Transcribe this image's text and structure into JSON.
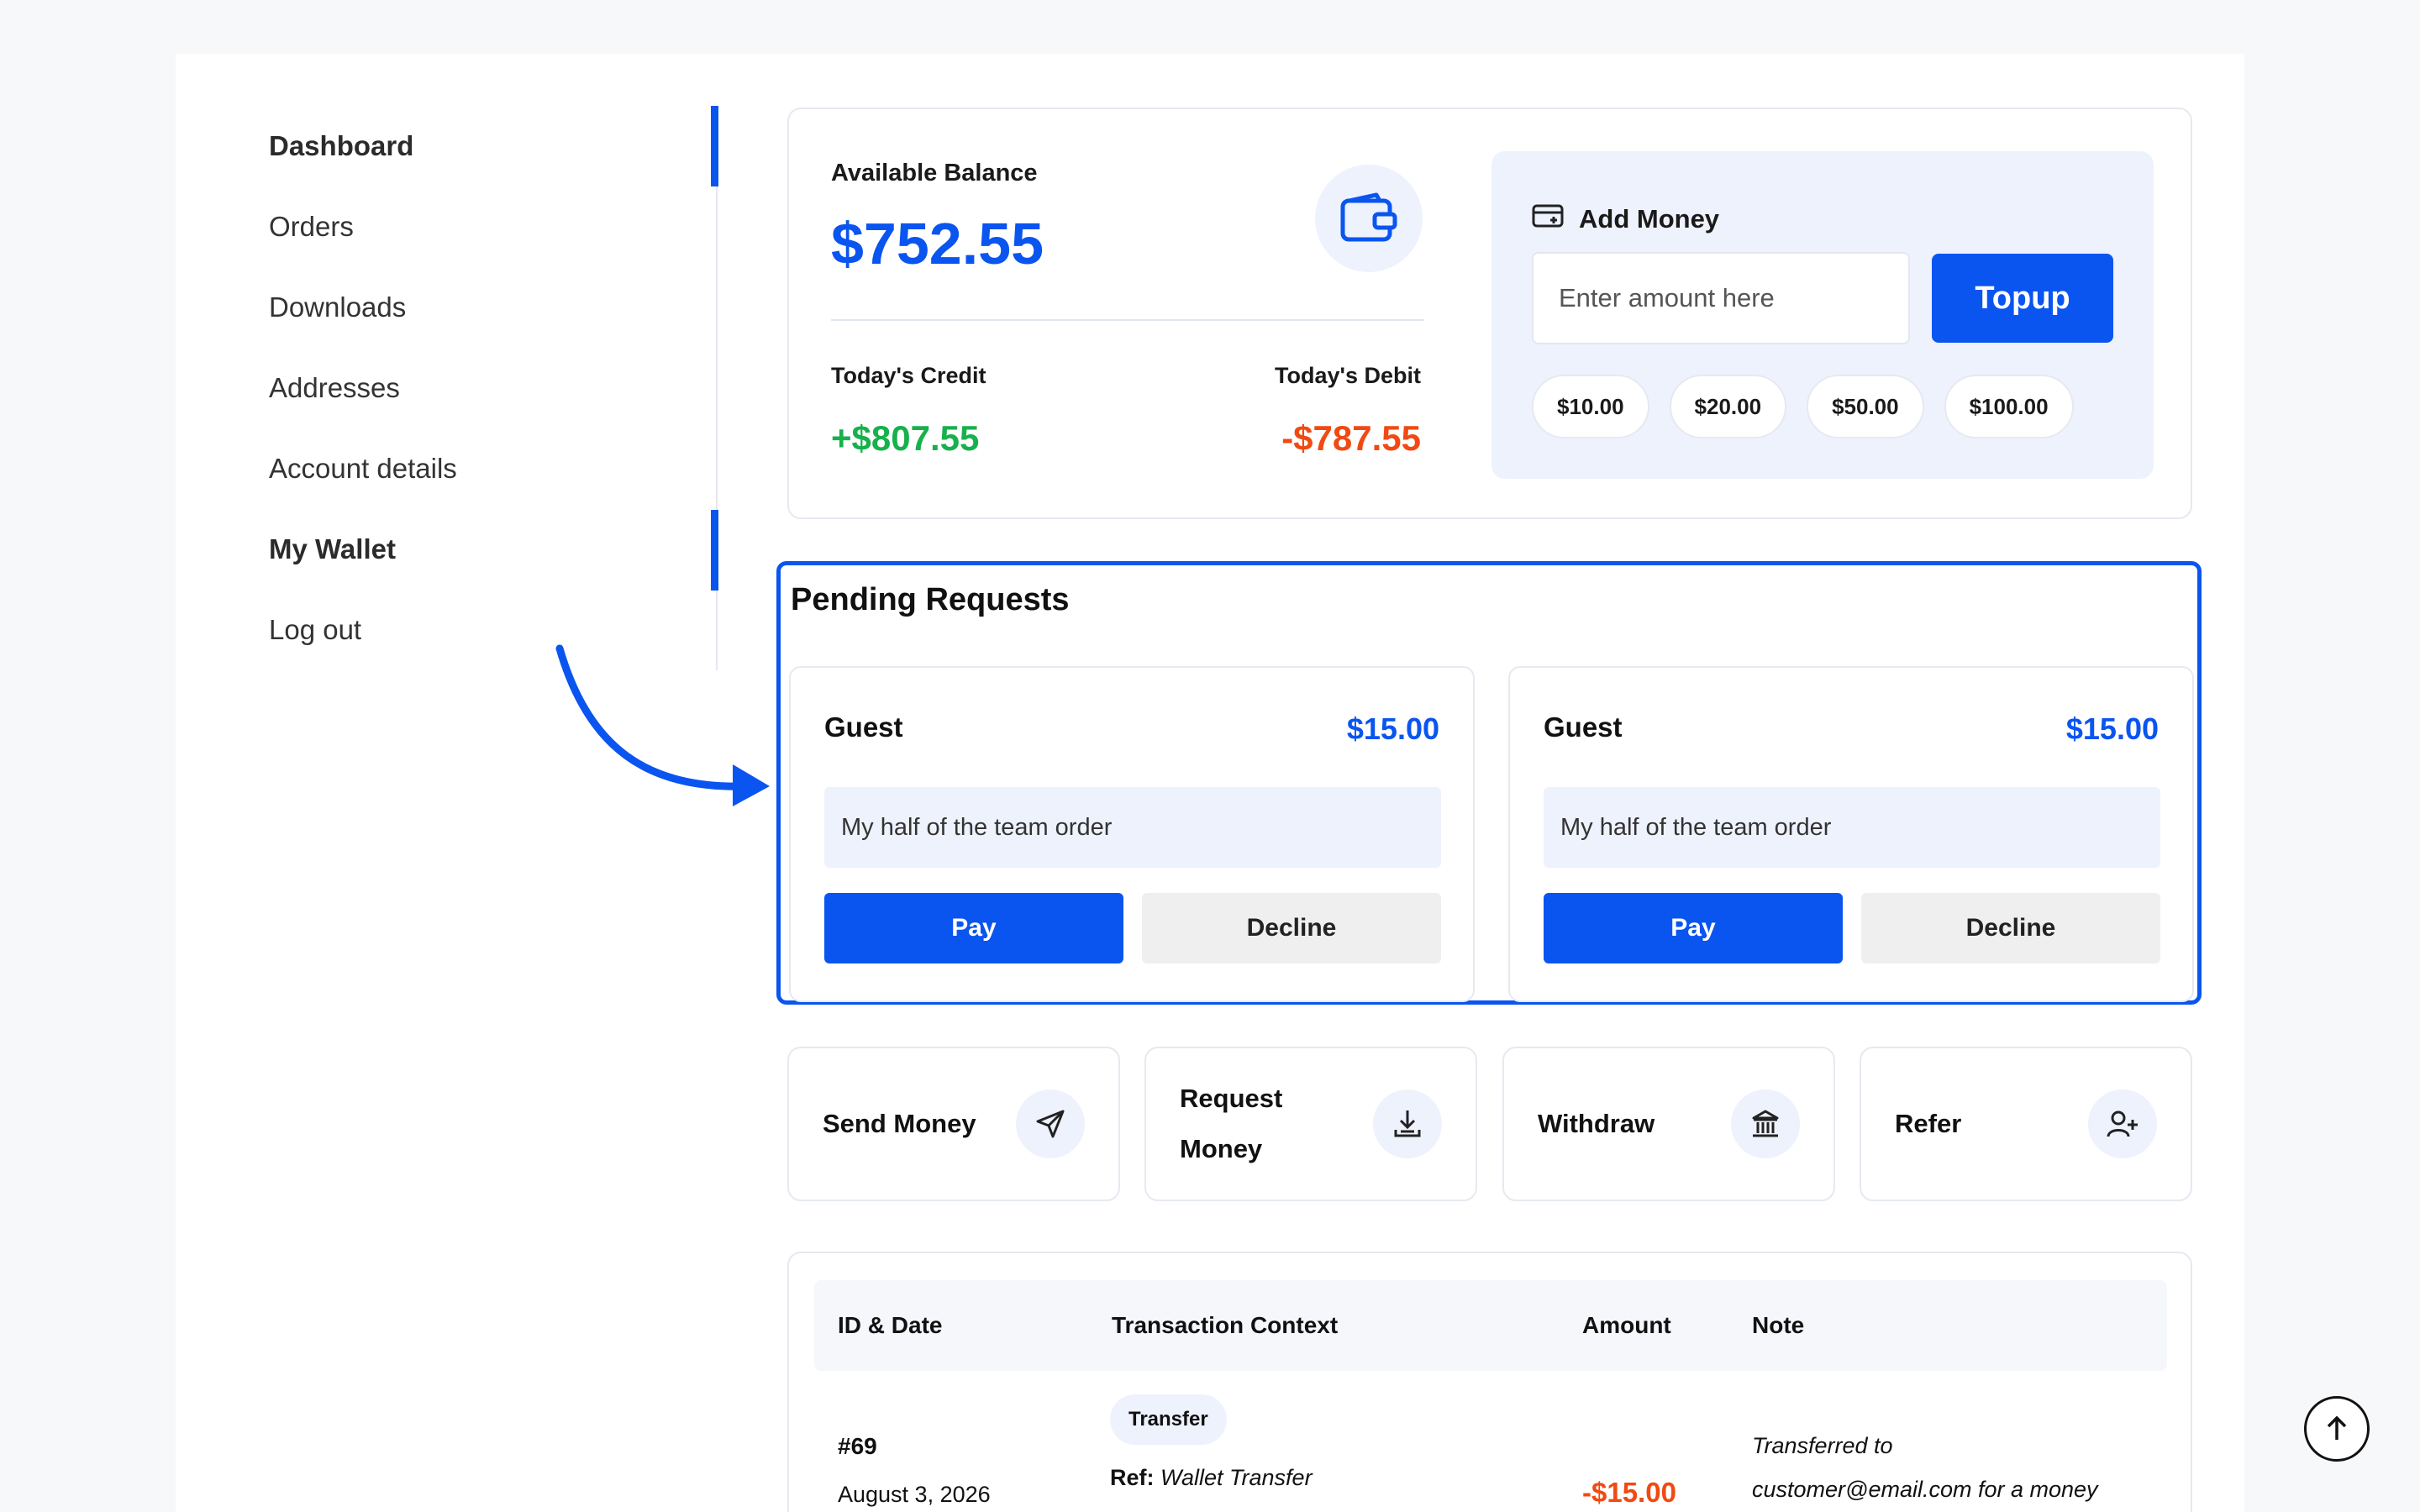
{
  "sidebar": {
    "items": [
      {
        "label": "Dashboard",
        "active": true
      },
      {
        "label": "Orders",
        "active": false
      },
      {
        "label": "Downloads",
        "active": false
      },
      {
        "label": "Addresses",
        "active": false
      },
      {
        "label": "Account details",
        "active": false
      },
      {
        "label": "My Wallet",
        "active": true
      },
      {
        "label": "Log out",
        "active": false
      }
    ]
  },
  "balance": {
    "label": "Available Balance",
    "value": "$752.55",
    "credit_label": "Today's Credit",
    "credit_value": "+$807.55",
    "debit_label": "Today's Debit",
    "debit_value": "-$787.55"
  },
  "add_money": {
    "title": "Add Money",
    "placeholder": "Enter amount here",
    "topup_label": "Topup",
    "chips": [
      "$10.00",
      "$20.00",
      "$50.00",
      "$100.00"
    ]
  },
  "pending": {
    "title": "Pending Requests",
    "requests": [
      {
        "name": "Guest",
        "amount": "$15.00",
        "note": "My half of the team order",
        "pay_label": "Pay",
        "decline_label": "Decline"
      },
      {
        "name": "Guest",
        "amount": "$15.00",
        "note": "My half of the team order",
        "pay_label": "Pay",
        "decline_label": "Decline"
      }
    ]
  },
  "actions": [
    {
      "label": "Send Money",
      "icon": "send-icon"
    },
    {
      "label": "Request Money",
      "icon": "download-icon"
    },
    {
      "label": "Withdraw",
      "icon": "bank-icon"
    },
    {
      "label": "Refer",
      "icon": "user-plus-icon"
    }
  ],
  "transactions": {
    "headers": [
      "ID & Date",
      "Transaction Context",
      "Amount",
      "Note"
    ],
    "rows": [
      {
        "id": "#69",
        "date": "August 3, 2026",
        "type": "Transfer",
        "ref_label": "Ref:",
        "ref_value": "Wallet Transfer",
        "amount": "-$15.00",
        "note_line1": "Transferred to",
        "note_line2": "customer@email.com for a money"
      }
    ]
  },
  "colors": {
    "accent": "#0a55f0",
    "credit": "#17b14c",
    "debit": "#f04a12",
    "panel": "#eef2fd"
  }
}
